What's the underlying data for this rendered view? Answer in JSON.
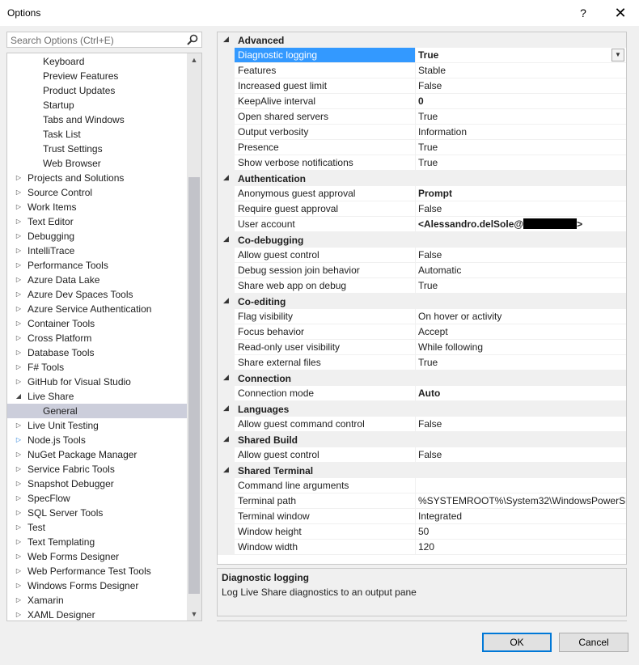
{
  "window": {
    "title": "Options",
    "help_label": "?",
    "close_label": "✕"
  },
  "search": {
    "placeholder": "Search Options (Ctrl+E)"
  },
  "tree": {
    "items": [
      {
        "label": "Keyboard",
        "indent": 2,
        "arrow": ""
      },
      {
        "label": "Preview Features",
        "indent": 2,
        "arrow": ""
      },
      {
        "label": "Product Updates",
        "indent": 2,
        "arrow": ""
      },
      {
        "label": "Startup",
        "indent": 2,
        "arrow": ""
      },
      {
        "label": "Tabs and Windows",
        "indent": 2,
        "arrow": ""
      },
      {
        "label": "Task List",
        "indent": 2,
        "arrow": ""
      },
      {
        "label": "Trust Settings",
        "indent": 2,
        "arrow": ""
      },
      {
        "label": "Web Browser",
        "indent": 2,
        "arrow": ""
      },
      {
        "label": "Projects and Solutions",
        "indent": 1,
        "arrow": "collapsed"
      },
      {
        "label": "Source Control",
        "indent": 1,
        "arrow": "collapsed"
      },
      {
        "label": "Work Items",
        "indent": 1,
        "arrow": "collapsed"
      },
      {
        "label": "Text Editor",
        "indent": 1,
        "arrow": "collapsed"
      },
      {
        "label": "Debugging",
        "indent": 1,
        "arrow": "collapsed"
      },
      {
        "label": "IntelliTrace",
        "indent": 1,
        "arrow": "collapsed"
      },
      {
        "label": "Performance Tools",
        "indent": 1,
        "arrow": "collapsed"
      },
      {
        "label": "Azure Data Lake",
        "indent": 1,
        "arrow": "collapsed"
      },
      {
        "label": "Azure Dev Spaces Tools",
        "indent": 1,
        "arrow": "collapsed"
      },
      {
        "label": "Azure Service Authentication",
        "indent": 1,
        "arrow": "collapsed"
      },
      {
        "label": "Container Tools",
        "indent": 1,
        "arrow": "collapsed"
      },
      {
        "label": "Cross Platform",
        "indent": 1,
        "arrow": "collapsed"
      },
      {
        "label": "Database Tools",
        "indent": 1,
        "arrow": "collapsed"
      },
      {
        "label": "F# Tools",
        "indent": 1,
        "arrow": "collapsed"
      },
      {
        "label": "GitHub for Visual Studio",
        "indent": 1,
        "arrow": "collapsed"
      },
      {
        "label": "Live Share",
        "indent": 1,
        "arrow": "expanded"
      },
      {
        "label": "General",
        "indent": 2,
        "arrow": "",
        "selected": true
      },
      {
        "label": "Live Unit Testing",
        "indent": 1,
        "arrow": "collapsed"
      },
      {
        "label": "Node.js Tools",
        "indent": 1,
        "arrow": "collapsed-blue"
      },
      {
        "label": "NuGet Package Manager",
        "indent": 1,
        "arrow": "collapsed"
      },
      {
        "label": "Service Fabric Tools",
        "indent": 1,
        "arrow": "collapsed"
      },
      {
        "label": "Snapshot Debugger",
        "indent": 1,
        "arrow": "collapsed"
      },
      {
        "label": "SpecFlow",
        "indent": 1,
        "arrow": "collapsed"
      },
      {
        "label": "SQL Server Tools",
        "indent": 1,
        "arrow": "collapsed"
      },
      {
        "label": "Test",
        "indent": 1,
        "arrow": "collapsed"
      },
      {
        "label": "Text Templating",
        "indent": 1,
        "arrow": "collapsed"
      },
      {
        "label": "Web Forms Designer",
        "indent": 1,
        "arrow": "collapsed"
      },
      {
        "label": "Web Performance Test Tools",
        "indent": 1,
        "arrow": "collapsed"
      },
      {
        "label": "Windows Forms Designer",
        "indent": 1,
        "arrow": "collapsed"
      },
      {
        "label": "Xamarin",
        "indent": 1,
        "arrow": "collapsed"
      },
      {
        "label": "XAML Designer",
        "indent": 1,
        "arrow": "collapsed"
      }
    ]
  },
  "grid": {
    "categories": [
      {
        "label": "Advanced",
        "rows": [
          {
            "name": "Diagnostic logging",
            "value": "True",
            "bold": true,
            "selected": true
          },
          {
            "name": "Features",
            "value": "Stable"
          },
          {
            "name": "Increased guest limit",
            "value": "False"
          },
          {
            "name": "KeepAlive interval",
            "value": "0",
            "bold": true
          },
          {
            "name": "Open shared servers",
            "value": "True"
          },
          {
            "name": "Output verbosity",
            "value": "Information"
          },
          {
            "name": "Presence",
            "value": "True"
          },
          {
            "name": "Show verbose notifications",
            "value": "True"
          }
        ]
      },
      {
        "label": "Authentication",
        "rows": [
          {
            "name": "Anonymous guest approval",
            "value": "Prompt",
            "bold": true
          },
          {
            "name": "Require guest approval",
            "value": "False"
          },
          {
            "name": "User account",
            "value": "<Alessandro.delSole@",
            "value_suffix": ">",
            "bold": true,
            "redacted": true
          }
        ]
      },
      {
        "label": "Co-debugging",
        "rows": [
          {
            "name": "Allow guest control",
            "value": "False"
          },
          {
            "name": "Debug session join behavior",
            "value": "Automatic"
          },
          {
            "name": "Share web app on debug",
            "value": "True"
          }
        ]
      },
      {
        "label": "Co-editing",
        "rows": [
          {
            "name": "Flag visibility",
            "value": "On hover or activity"
          },
          {
            "name": "Focus behavior",
            "value": "Accept"
          },
          {
            "name": "Read-only user visibility",
            "value": "While following"
          },
          {
            "name": "Share external files",
            "value": "True"
          }
        ]
      },
      {
        "label": "Connection",
        "rows": [
          {
            "name": "Connection mode",
            "value": "Auto",
            "bold": true
          }
        ]
      },
      {
        "label": "Languages",
        "rows": [
          {
            "name": "Allow guest command control",
            "value": "False"
          }
        ]
      },
      {
        "label": "Shared Build",
        "rows": [
          {
            "name": "Allow guest control",
            "value": "False"
          }
        ]
      },
      {
        "label": "Shared Terminal",
        "rows": [
          {
            "name": "Command line arguments",
            "value": ""
          },
          {
            "name": "Terminal path",
            "value": "%SYSTEMROOT%\\System32\\WindowsPowerShell"
          },
          {
            "name": "Terminal window",
            "value": "Integrated"
          },
          {
            "name": "Window height",
            "value": "50"
          },
          {
            "name": "Window width",
            "value": "120"
          }
        ]
      }
    ]
  },
  "description": {
    "title": "Diagnostic logging",
    "text": "Log Live Share diagnostics to an output pane"
  },
  "buttons": {
    "ok": "OK",
    "cancel": "Cancel"
  }
}
